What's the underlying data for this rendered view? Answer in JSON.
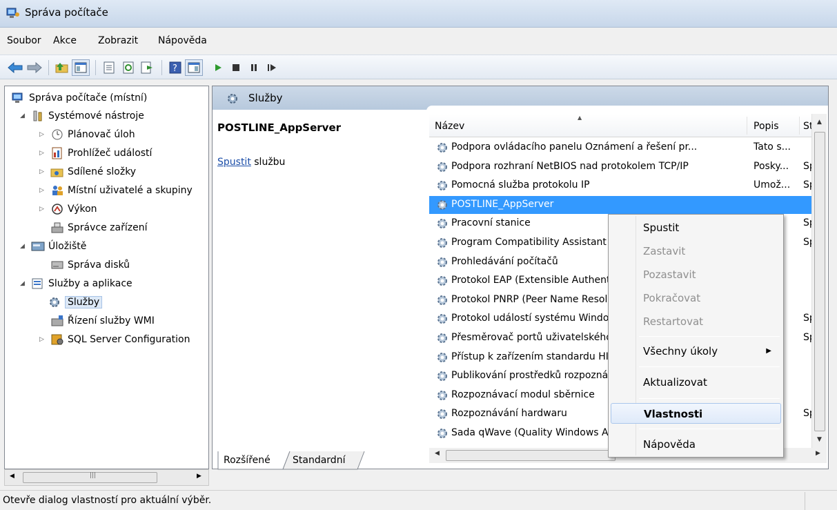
{
  "window": {
    "title": "Správa počítače"
  },
  "menu": [
    "Soubor",
    "Akce",
    "Zobrazit",
    "Nápověda"
  ],
  "tree": {
    "items": [
      {
        "label": "Správa počítače (místní)"
      },
      {
        "label": "Systémové nástroje"
      },
      {
        "label": "Plánovač úloh"
      },
      {
        "label": "Prohlížeč událostí"
      },
      {
        "label": "Sdílené složky"
      },
      {
        "label": "Místní uživatelé a skupiny"
      },
      {
        "label": "Výkon"
      },
      {
        "label": "Správce zařízení"
      },
      {
        "label": "Úložiště"
      },
      {
        "label": "Správa disků"
      },
      {
        "label": "Služby a aplikace"
      },
      {
        "label": "Služby"
      },
      {
        "label": "Řízení služby WMI"
      },
      {
        "label": "SQL Server Configuration"
      }
    ]
  },
  "services": {
    "header_title": "Služby",
    "detail_title": "POSTLINE_AppServer",
    "detail_link": "Spustit",
    "detail_link_suffix": " službu",
    "columns": {
      "name": "Název",
      "desc": "Popis",
      "start": "St"
    },
    "rows": [
      {
        "name": "Podpora ovládacího panelu Oznámení a řešení pr...",
        "desc": "Tato s...",
        "start": ""
      },
      {
        "name": "Podpora rozhraní NetBIOS nad protokolem TCP/IP",
        "desc": "Posky...",
        "start": "Sp"
      },
      {
        "name": "Pomocná služba protokolu IP",
        "desc": "Umož...",
        "start": "Sp"
      },
      {
        "name": "POSTLINE_AppServer",
        "desc": "",
        "start": ""
      },
      {
        "name": "Pracovní stanice",
        "desc": "...",
        "start": "Sp"
      },
      {
        "name": "Program Compatibility Assistant",
        "desc": "...",
        "start": "Sp"
      },
      {
        "name": "Prohledávání počítačů",
        "desc": "...",
        "start": ""
      },
      {
        "name": "Protokol EAP (Extensible Authentication)",
        "desc": "...",
        "start": ""
      },
      {
        "name": "Protokol PNRP (Peer Name Resolution)",
        "desc": "...",
        "start": ""
      },
      {
        "name": "Protokol událostí systému Windows",
        "desc": "...",
        "start": "Sp"
      },
      {
        "name": "Přesměrovač portů uživatelského režimu",
        "desc": "...",
        "start": "Sp"
      },
      {
        "name": "Přístup k zařízením standardu HID",
        "desc": "...",
        "start": ""
      },
      {
        "name": "Publikování prostředků rozpoznávání",
        "desc": "...",
        "start": ""
      },
      {
        "name": "Rozpoznávací modul sběrnice",
        "desc": "...",
        "start": ""
      },
      {
        "name": "Rozpoznávání hardwaru",
        "desc": "...",
        "start": "Sp"
      },
      {
        "name": "Sada qWave (Quality Windows Audio Video)",
        "desc": "...",
        "start": ""
      }
    ]
  },
  "tabs": [
    "Rozšířené",
    "Standardní"
  ],
  "context_menu": {
    "items": [
      "Spustit",
      "Zastavit",
      "Pozastavit",
      "Pokračovat",
      "Restartovat",
      "Všechny úkoly",
      "Aktualizovat",
      "Vlastnosti",
      "Nápověda"
    ]
  },
  "status": "Otevře dialog vlastností pro aktuální výběr.",
  "colors": {
    "selection": "#3399ff",
    "header_band": "#b7c9dd",
    "link": "#1c4ea8"
  }
}
